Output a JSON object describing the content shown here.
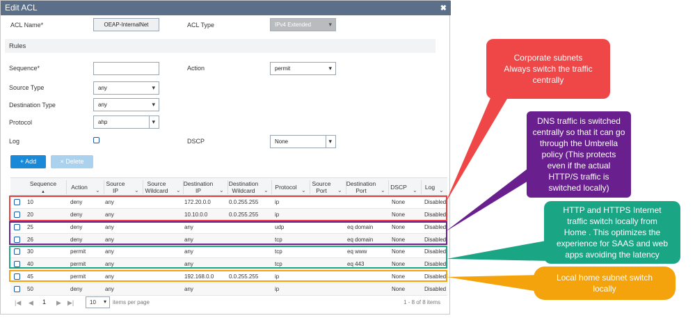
{
  "dialog": {
    "title": "Edit ACL",
    "close_glyph": "✖"
  },
  "form": {
    "acl_name_label": "ACL Name*",
    "acl_name_value": "OEAP-InternalNet",
    "acl_type_label": "ACL Type",
    "acl_type_value": "IPv4 Extended",
    "rules_heading": "Rules",
    "sequence_label": "Sequence*",
    "sequence_value": "",
    "action_label": "Action",
    "action_value": "permit",
    "source_type_label": "Source Type",
    "source_type_value": "any",
    "destination_type_label": "Destination Type",
    "destination_type_value": "any",
    "protocol_label": "Protocol",
    "protocol_value": "ahp",
    "log_label": "Log",
    "dscp_label": "DSCP",
    "dscp_value": "None"
  },
  "buttons": {
    "add_label": "+ Add",
    "delete_label": "× Delete"
  },
  "table": {
    "headers": {
      "sequence": "Sequence",
      "sort_glyph": "▲",
      "action": "Action",
      "source_ip_1": "Source",
      "source_ip_2": "IP",
      "source_wildcard_1": "Source",
      "source_wildcard_2": "Wildcard",
      "destination_ip_1": "Destination",
      "destination_ip_2": "IP",
      "destination_wildcard_1": "Destination",
      "destination_wildcard_2": "Wildcard",
      "protocol": "Protocol",
      "source_port_1": "Source",
      "source_port_2": "Port",
      "destination_port_1": "Destination",
      "destination_port_2": "Port",
      "dscp": "DSCP",
      "log": "Log"
    },
    "rows": [
      {
        "seq": "10",
        "action": "deny",
        "src_ip": "any",
        "dst_ip": "172.20.0.0",
        "dst_wc": "0.0.255.255",
        "protocol": "ip",
        "dst_port": "",
        "dscp": "None",
        "log": "Disabled"
      },
      {
        "seq": "20",
        "action": "deny",
        "src_ip": "any",
        "dst_ip": "10.10.0.0",
        "dst_wc": "0.0.255.255",
        "protocol": "ip",
        "dst_port": "",
        "dscp": "None",
        "log": "Disabled"
      },
      {
        "seq": "25",
        "action": "deny",
        "src_ip": "any",
        "dst_ip": "any",
        "dst_wc": "",
        "protocol": "udp",
        "dst_port": "eq domain",
        "dscp": "None",
        "log": "Disabled"
      },
      {
        "seq": "26",
        "action": "deny",
        "src_ip": "any",
        "dst_ip": "any",
        "dst_wc": "",
        "protocol": "tcp",
        "dst_port": "eq domain",
        "dscp": "None",
        "log": "Disabled"
      },
      {
        "seq": "30",
        "action": "permit",
        "src_ip": "any",
        "dst_ip": "any",
        "dst_wc": "",
        "protocol": "tcp",
        "dst_port": "eq www",
        "dscp": "None",
        "log": "Disabled"
      },
      {
        "seq": "40",
        "action": "permit",
        "src_ip": "any",
        "dst_ip": "any",
        "dst_wc": "",
        "protocol": "tcp",
        "dst_port": "eq 443",
        "dscp": "None",
        "log": "Disabled"
      },
      {
        "seq": "45",
        "action": "permit",
        "src_ip": "any",
        "dst_ip": "192.168.0.0",
        "dst_wc": "0.0.255.255",
        "protocol": "ip",
        "dst_port": "",
        "dscp": "None",
        "log": "Disabled"
      },
      {
        "seq": "50",
        "action": "deny",
        "src_ip": "any",
        "dst_ip": "any",
        "dst_wc": "",
        "protocol": "ip",
        "dst_port": "",
        "dscp": "None",
        "log": "Disabled"
      }
    ]
  },
  "pager": {
    "first_glyph": "|◀",
    "prev_glyph": "◀",
    "page": "1",
    "next_glyph": "▶",
    "last_glyph": "▶|",
    "per_page_value": "10",
    "per_page_label": "items per page",
    "count_text": "1 - 8 of 8 items"
  },
  "callouts": {
    "corporate": {
      "line1": "Corporate subnets",
      "line2": "Always switch the traffic",
      "line3": "centrally",
      "color": "#ef4648"
    },
    "dns": {
      "line1": "DNS traffic is switched",
      "line2": "centrally so that it can go",
      "line3": "through the Umbrella",
      "line4": "policy (This protects",
      "line5": "even if the actual",
      "line6": "HTTP/S traffic is",
      "line7": "switched locally)",
      "color": "#6a1f8f"
    },
    "http": {
      "line1": "HTTP and HTTPS Internet",
      "line2": "traffic switch locally from",
      "line3": "Home . This optimizes the",
      "line4": "experience for SAAS and web",
      "line5": "apps avoiding the latency",
      "color": "#1aa585"
    },
    "local": {
      "line1": "Local home subnet switch",
      "line2": "locally",
      "color": "#f4a30d"
    }
  },
  "colors": {
    "titlebar": "#5b6f88",
    "add_button": "#1a89d8",
    "delete_button": "#aad2ee",
    "checkbox_border": "#1a5ba8"
  }
}
